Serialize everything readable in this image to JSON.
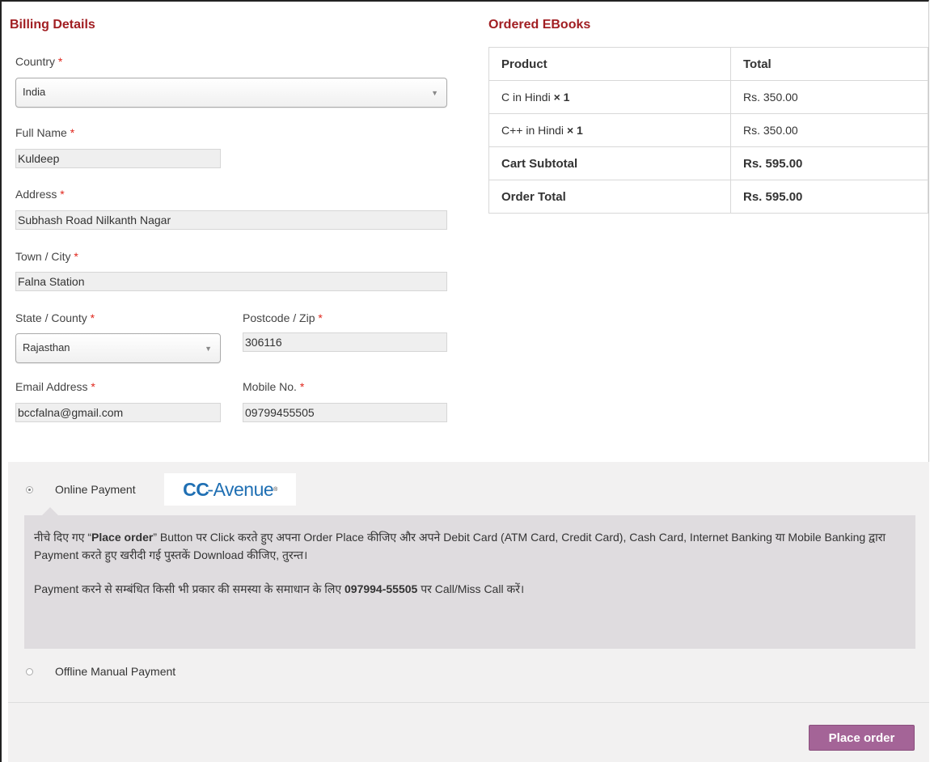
{
  "billing": {
    "heading": "Billing Details",
    "country_label": "Country",
    "country_value": "India",
    "fullname_label": "Full Name",
    "fullname_value": "Kuldeep",
    "address_label": "Address",
    "address_value": "Subhash Road Nilkanth Nagar",
    "city_label": "Town / City",
    "city_value": "Falna Station",
    "state_label": "State / County",
    "state_value": "Rajasthan",
    "zip_label": "Postcode / Zip",
    "zip_value": "306116",
    "email_label": "Email Address",
    "email_value": "bccfalna@gmail.com",
    "mobile_label": "Mobile No.",
    "mobile_value": "09799455505",
    "required_mark": "*"
  },
  "order": {
    "heading": "Ordered EBooks",
    "col_product": "Product",
    "col_total": "Total",
    "items": [
      {
        "name": "C in Hindi",
        "qty": "× 1",
        "total": "Rs. 350.00"
      },
      {
        "name": "C++ in Hindi",
        "qty": "× 1",
        "total": "Rs. 350.00"
      }
    ],
    "subtotal_label": "Cart Subtotal",
    "subtotal_value": "Rs. 595.00",
    "total_label": "Order Total",
    "total_value": "Rs. 595.00"
  },
  "payment": {
    "online_label": "Online Payment",
    "logo_text": "CC",
    "logo_text2": "Avenue",
    "logo_mark": "®",
    "info_line1_a": "नीचे दिए गए “",
    "info_line1_bold": "Place order",
    "info_line1_b": "” Button पर Click करते हुए अपना Order Place कीजिए और अपने Debit Card (ATM Card, Credit Card), Cash Card, Internet Banking या Mobile Banking द्वारा Payment करते हुए खरीदी गई पुस्तकें Download कीजिए, तुरन्त।",
    "info_line2_a": "Payment करने से सम्बंधित किसी भी प्रकार की समस्या के समाधान के लिए ",
    "info_line2_bold": "097994-55505",
    "info_line2_b": " पर Call/Miss Call करें।",
    "offline_label": "Offline Manual Payment",
    "place_order": "Place order"
  },
  "colors": {
    "heading": "#a11e22",
    "button": "#a46497",
    "logo": "#1f6fb3"
  }
}
